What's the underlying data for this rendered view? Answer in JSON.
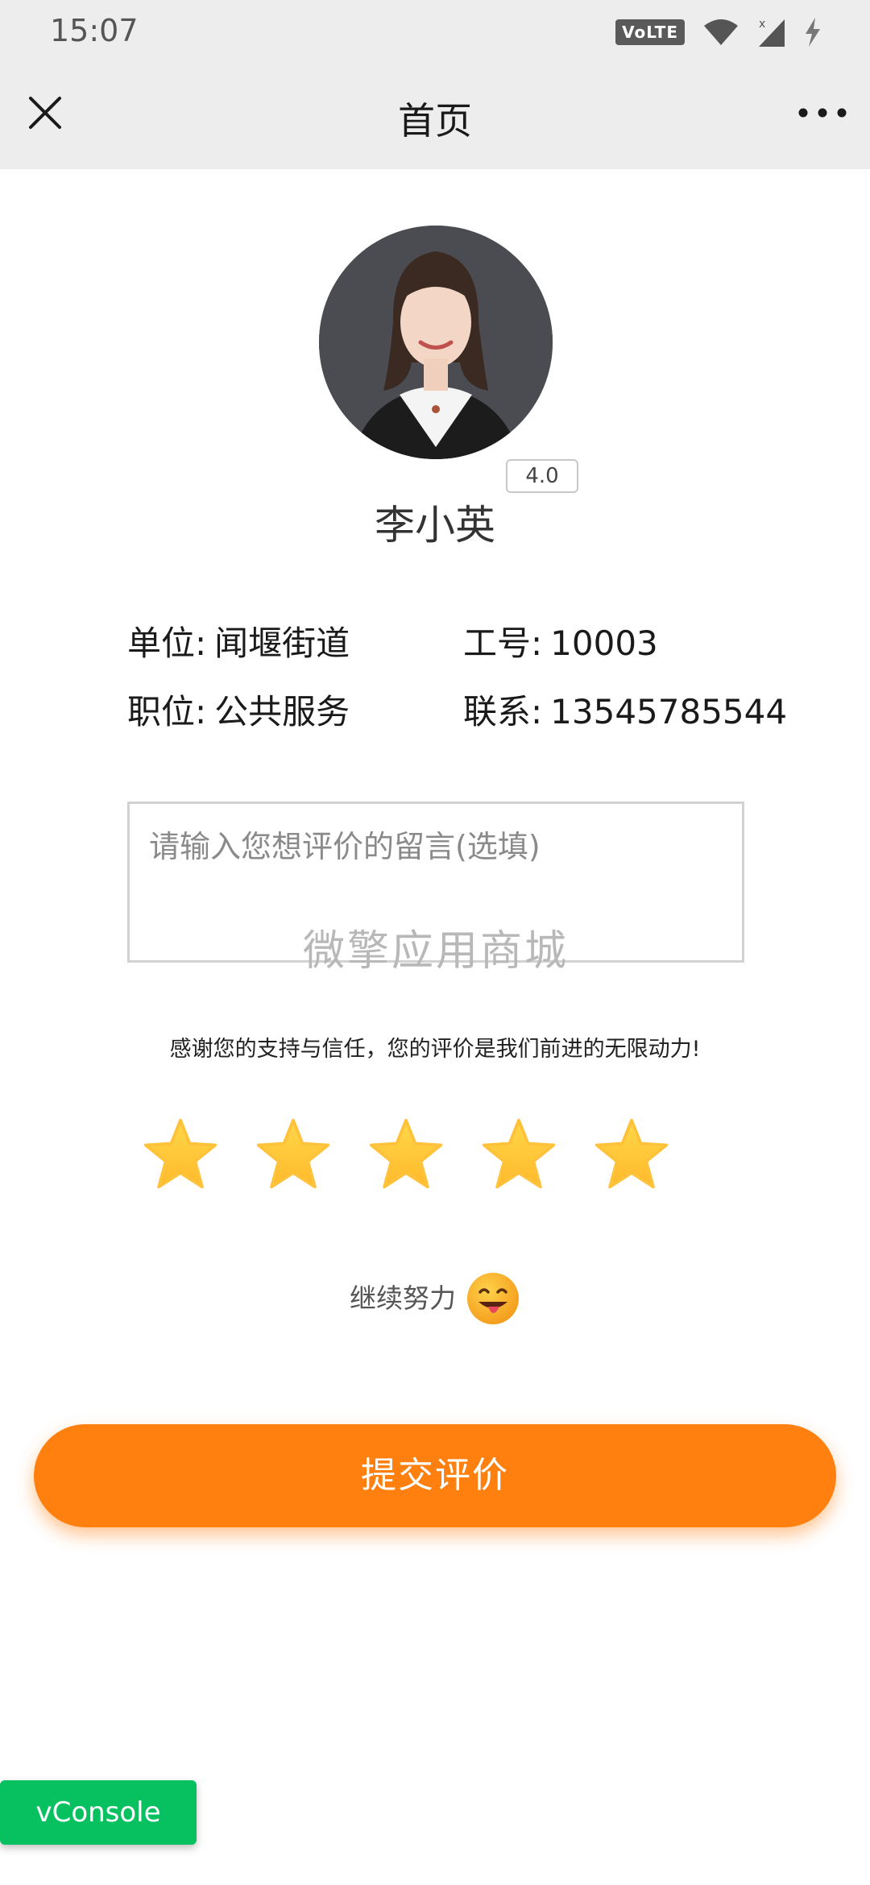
{
  "status_bar": {
    "time": "15:07",
    "network_badge": "VoLTE"
  },
  "navbar": {
    "title": "首页",
    "close_icon": "close-icon",
    "more_icon": "more-icon"
  },
  "profile": {
    "name": "李小英",
    "rating": "4.0",
    "unit_label": "单位:",
    "unit_value": "闻堰街道",
    "job_id_label": "工号:",
    "job_id_value": "10003",
    "position_label": "职位:",
    "position_value": "公共服务",
    "contact_label": "联系:",
    "contact_value": "13545785544"
  },
  "comment": {
    "placeholder": "请输入您想评价的留言(选填)",
    "value": "",
    "watermark": "微擎应用商城"
  },
  "thanks_text": "感谢您的支持与信任，您的评价是我们前进的无限动力!",
  "rating_stars": {
    "selected": 5,
    "max": 5,
    "color": "#ffc83a"
  },
  "feedback": {
    "text": "继续努力",
    "icon": "tongue-face-icon"
  },
  "submit_button": {
    "label": "提交评价",
    "color": "#ff7f0f"
  },
  "vconsole": {
    "label": "vConsole",
    "color": "#07c160"
  }
}
